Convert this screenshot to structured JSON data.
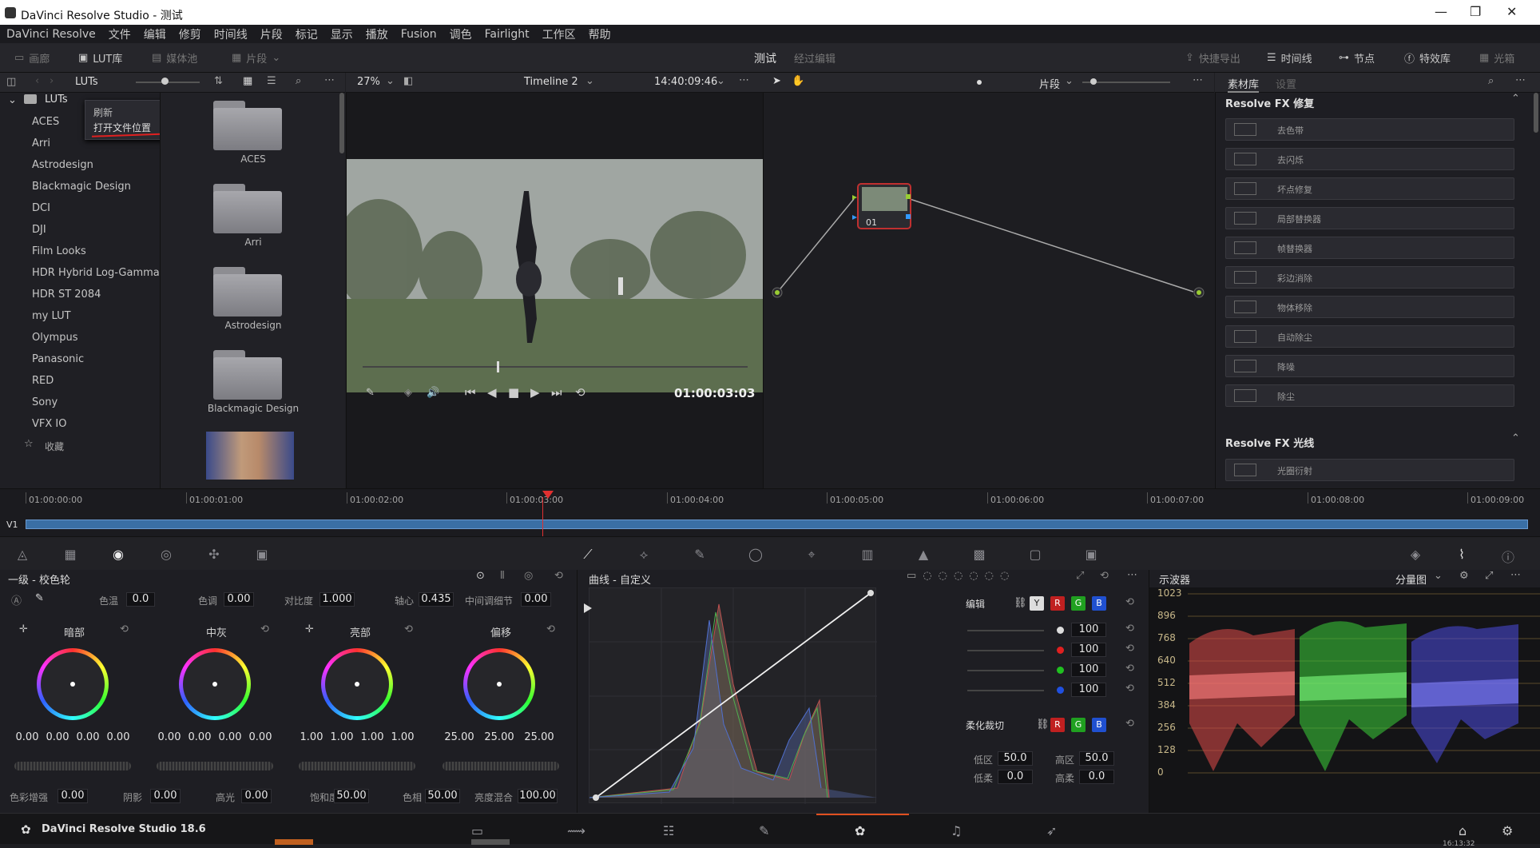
{
  "window": {
    "title": "DaVinci Resolve Studio - 测试",
    "min": "—",
    "max": "❐",
    "close": "✕"
  },
  "menu": [
    "DaVinci Resolve",
    "文件",
    "编辑",
    "修剪",
    "时间线",
    "片段",
    "标记",
    "显示",
    "播放",
    "Fusion",
    "调色",
    "Fairlight",
    "工作区",
    "帮助"
  ],
  "toolbar": {
    "left": [
      {
        "label": "画廊",
        "icon": "gallery-icon"
      },
      {
        "label": "LUT库",
        "icon": "lut-icon"
      },
      {
        "label": "媒体池",
        "icon": "mediapool-icon"
      },
      {
        "label": "片段",
        "icon": "clips-icon"
      }
    ],
    "project": "测试",
    "edited": "经过编辑",
    "right": [
      {
        "label": "快捷导出",
        "icon": "export-icon"
      },
      {
        "label": "时间线",
        "icon": "timeline-icon"
      },
      {
        "label": "节点",
        "icon": "nodes-icon"
      },
      {
        "label": "特效库",
        "icon": "fx-icon"
      },
      {
        "label": "光箱",
        "icon": "lightbox-icon"
      }
    ]
  },
  "luts": {
    "header": "LUTs",
    "root": "LUTs",
    "items": [
      "ACES",
      "Arri",
      "Astrodesign",
      "Blackmagic Design",
      "DCI",
      "DJI",
      "Film Looks",
      "HDR Hybrid Log-Gamma",
      "HDR ST 2084",
      "my LUT",
      "Olympus",
      "Panasonic",
      "RED",
      "Sony",
      "VFX IO"
    ],
    "favorites": "收藏",
    "context_menu": [
      "刷新",
      "打开文件位置"
    ],
    "thumbs": [
      "ACES",
      "Arri",
      "Astrodesign",
      "Blackmagic Design"
    ]
  },
  "viewer": {
    "zoom": "27%",
    "timeline": "Timeline 2",
    "timecode": "14:40:09:46",
    "playhead": "01:00:03:03"
  },
  "nodes": {
    "mode": "片段",
    "node_label": "01"
  },
  "fx": {
    "tab_active": "素材库",
    "tab_inactive": "设置",
    "section1": "Resolve FX 修复",
    "items": [
      "去色带",
      "去闪烁",
      "坏点修复",
      "局部替换器",
      "帧替换器",
      "彩边消除",
      "物体移除",
      "自动除尘",
      "降噪",
      "除尘"
    ],
    "section2": "Resolve FX 光线",
    "items2": [
      "光圈衍射"
    ]
  },
  "timeline": {
    "track": "V1",
    "timecodes": [
      "01:00:00:00",
      "01:00:01:00",
      "01:00:02:00",
      "01:00:03:00",
      "01:00:04:00",
      "01:00:05:00",
      "01:00:06:00",
      "01:00:07:00",
      "01:00:08:00",
      "01:00:09:00"
    ]
  },
  "primaries": {
    "title": "一级 - 校色轮",
    "params": [
      {
        "label": "色温",
        "value": "0.0"
      },
      {
        "label": "色调",
        "value": "0.00"
      },
      {
        "label": "对比度",
        "value": "1.000"
      },
      {
        "label": "轴心",
        "value": "0.435"
      },
      {
        "label": "中间调细节",
        "value": "0.00"
      }
    ],
    "wheels": [
      {
        "label": "暗部",
        "values": [
          "0.00",
          "0.00",
          "0.00",
          "0.00"
        ]
      },
      {
        "label": "中灰",
        "values": [
          "0.00",
          "0.00",
          "0.00",
          "0.00"
        ]
      },
      {
        "label": "亮部",
        "values": [
          "1.00",
          "1.00",
          "1.00",
          "1.00"
        ]
      },
      {
        "label": "偏移",
        "values": [
          "25.00",
          "25.00",
          "25.00"
        ]
      }
    ],
    "bottom": [
      {
        "label": "色彩增强",
        "value": "0.00"
      },
      {
        "label": "阴影",
        "value": "0.00"
      },
      {
        "label": "高光",
        "value": "0.00"
      },
      {
        "label": "饱和度",
        "value": "50.00"
      },
      {
        "label": "色相",
        "value": "50.00"
      },
      {
        "label": "亮度混合",
        "value": "100.00"
      }
    ]
  },
  "curves": {
    "title": "曲线 - 自定义",
    "edit": "编辑",
    "channels": [
      "Y",
      "R",
      "G",
      "B"
    ],
    "intensity": [
      "100",
      "100",
      "100",
      "100"
    ],
    "soft_clip": "柔化裁切",
    "low": "低区",
    "low_val": "50.0",
    "high": "高区",
    "high_val": "50.0",
    "low_soft": "低柔",
    "low_soft_val": "0.0",
    "high_soft": "高柔",
    "high_soft_val": "0.0"
  },
  "scope": {
    "title": "示波器",
    "mode": "分量图",
    "ticks": [
      "1023",
      "896",
      "768",
      "640",
      "512",
      "384",
      "256",
      "128",
      "0"
    ]
  },
  "app": {
    "name": "DaVinci Resolve Studio 18.6",
    "clock": "16:13:32"
  }
}
